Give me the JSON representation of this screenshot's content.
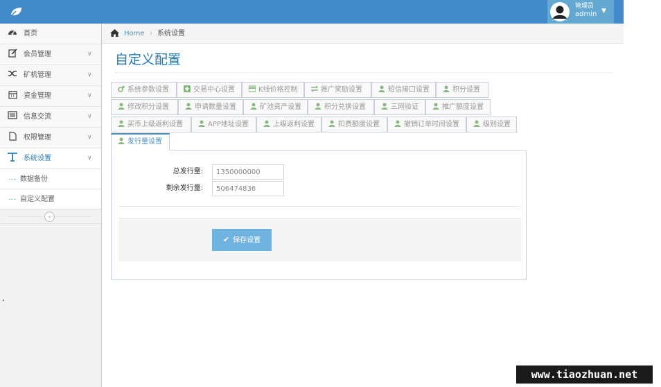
{
  "user": {
    "role": "管理员",
    "name": "admin"
  },
  "sidebar": {
    "items": [
      {
        "label": "首页",
        "icon": "dashboard-icon",
        "has_arrow": false
      },
      {
        "label": "会员管理",
        "icon": "edit-icon",
        "has_arrow": true
      },
      {
        "label": "矿机管理",
        "icon": "shuffle-icon",
        "has_arrow": true
      },
      {
        "label": "资金管理",
        "icon": "calendar-icon",
        "has_arrow": true
      },
      {
        "label": "信息交流",
        "icon": "list-icon",
        "has_arrow": true
      },
      {
        "label": "权限管理",
        "icon": "file-icon",
        "has_arrow": true
      },
      {
        "label": "系统设置",
        "icon": "text-icon",
        "has_arrow": true
      }
    ],
    "subitems": [
      "数据备份",
      "自定义配置"
    ],
    "collapse_glyph": "«"
  },
  "breadcrumb": {
    "home": "Home",
    "separator": "›",
    "current": "系统设置"
  },
  "page": {
    "title": "自定义配置"
  },
  "tabs": {
    "row1": [
      {
        "label": "系统参数设置",
        "icon": "cogs-icon"
      },
      {
        "label": "交易中心设置",
        "icon": "plus-square-icon"
      },
      {
        "label": "K线价格控制",
        "icon": "credit-card-icon"
      },
      {
        "label": "推广奖励设置",
        "icon": "exchange-icon"
      },
      {
        "label": "短信接口设置",
        "icon": "user-icon"
      },
      {
        "label": "积分设置",
        "icon": "user-icon"
      }
    ],
    "row2": [
      {
        "label": "修改积分设置",
        "icon": "user-icon"
      },
      {
        "label": "申请数量设置",
        "icon": "user-icon"
      },
      {
        "label": "矿池资产设置",
        "icon": "user-icon"
      },
      {
        "label": "积分兑换设置",
        "icon": "user-icon"
      },
      {
        "label": "三网验证",
        "icon": "user-icon"
      },
      {
        "label": "推广额度设置",
        "icon": "user-icon"
      }
    ],
    "row3": [
      {
        "label": "买币上级返利设置",
        "icon": "user-icon"
      },
      {
        "label": "APP地址设置",
        "icon": "user-icon"
      },
      {
        "label": "上级返利设置",
        "icon": "user-icon"
      },
      {
        "label": "扣费额度设置",
        "icon": "user-icon"
      },
      {
        "label": "撤销订单时间设置",
        "icon": "user-icon"
      },
      {
        "label": "级别设置",
        "icon": "user-icon"
      }
    ],
    "row4": [
      {
        "label": "发行量设置",
        "icon": "user-icon",
        "active": true
      }
    ]
  },
  "form": {
    "total_label": "总发行量:",
    "total_value": "1350000000",
    "remaining_label": "剩余发行量:",
    "remaining_value": "506474836",
    "save_label": "保存设置"
  },
  "watermark": "www.tiaozhuan.net",
  "colors": {
    "topbar": "#428bca",
    "user_area": "#62a8d1",
    "accent": "#2679b5",
    "tab_green": "#87b87f",
    "save_button": "#6fb3e0"
  }
}
